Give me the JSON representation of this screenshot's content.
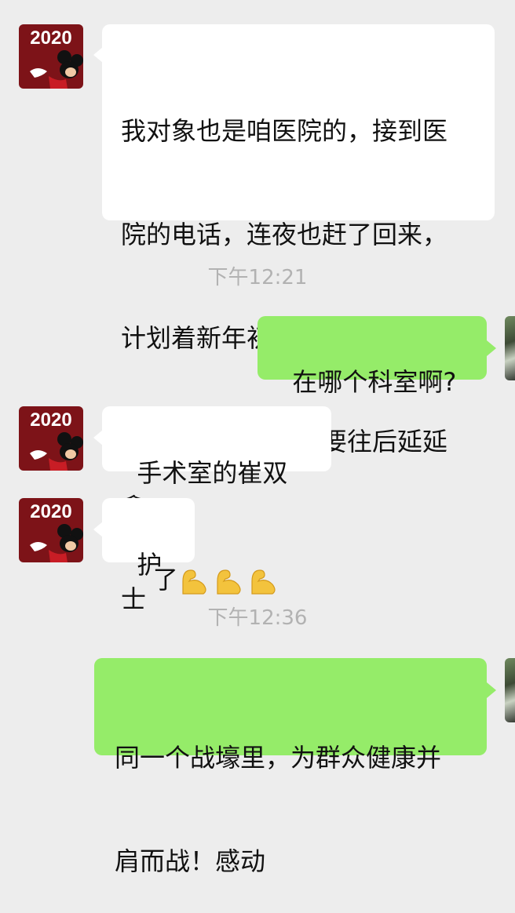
{
  "messages": [
    {
      "side": "in",
      "avatar": {
        "year": "2020",
        "icon": "mickey-2020-avatar"
      },
      "text": "我对象也是咱医院的，接到医院的电话，连夜也赶了回来，计划着新年初九要去安阳父母商量订婚呢，看来要往后延延了",
      "lines": [
        "我对象也是咱医院的，接到医",
        "院的电话，连夜也赶了回来，",
        "计划着新年初九要去安阳父母",
        "商量订婚呢，看来要往后延延",
        "了"
      ],
      "emoji": [
        "flexed-biceps",
        "flexed-biceps",
        "flexed-biceps"
      ]
    },
    {
      "type": "time",
      "text": "下午12:21"
    },
    {
      "side": "out",
      "text": "在哪个科室啊?"
    },
    {
      "side": "in",
      "avatar": {
        "year": "2020",
        "icon": "mickey-2020-avatar"
      },
      "text": "手术室的崔双鑫"
    },
    {
      "side": "in",
      "avatar": {
        "year": "2020",
        "icon": "mickey-2020-avatar"
      },
      "text": "护士"
    },
    {
      "type": "time",
      "text": "下午12:36"
    },
    {
      "side": "out",
      "text": "同一个战壕里，为群众健康并肩而战！感动",
      "lines": [
        "同一个战壕里，为群众健康并",
        "肩而战！感动"
      ]
    }
  ],
  "colors": {
    "background": "#ededed",
    "incoming_bubble": "#ffffff",
    "outgoing_bubble": "#95ec69",
    "timestamp": "#b2b2b2",
    "avatar_bg": "#7d1318"
  }
}
